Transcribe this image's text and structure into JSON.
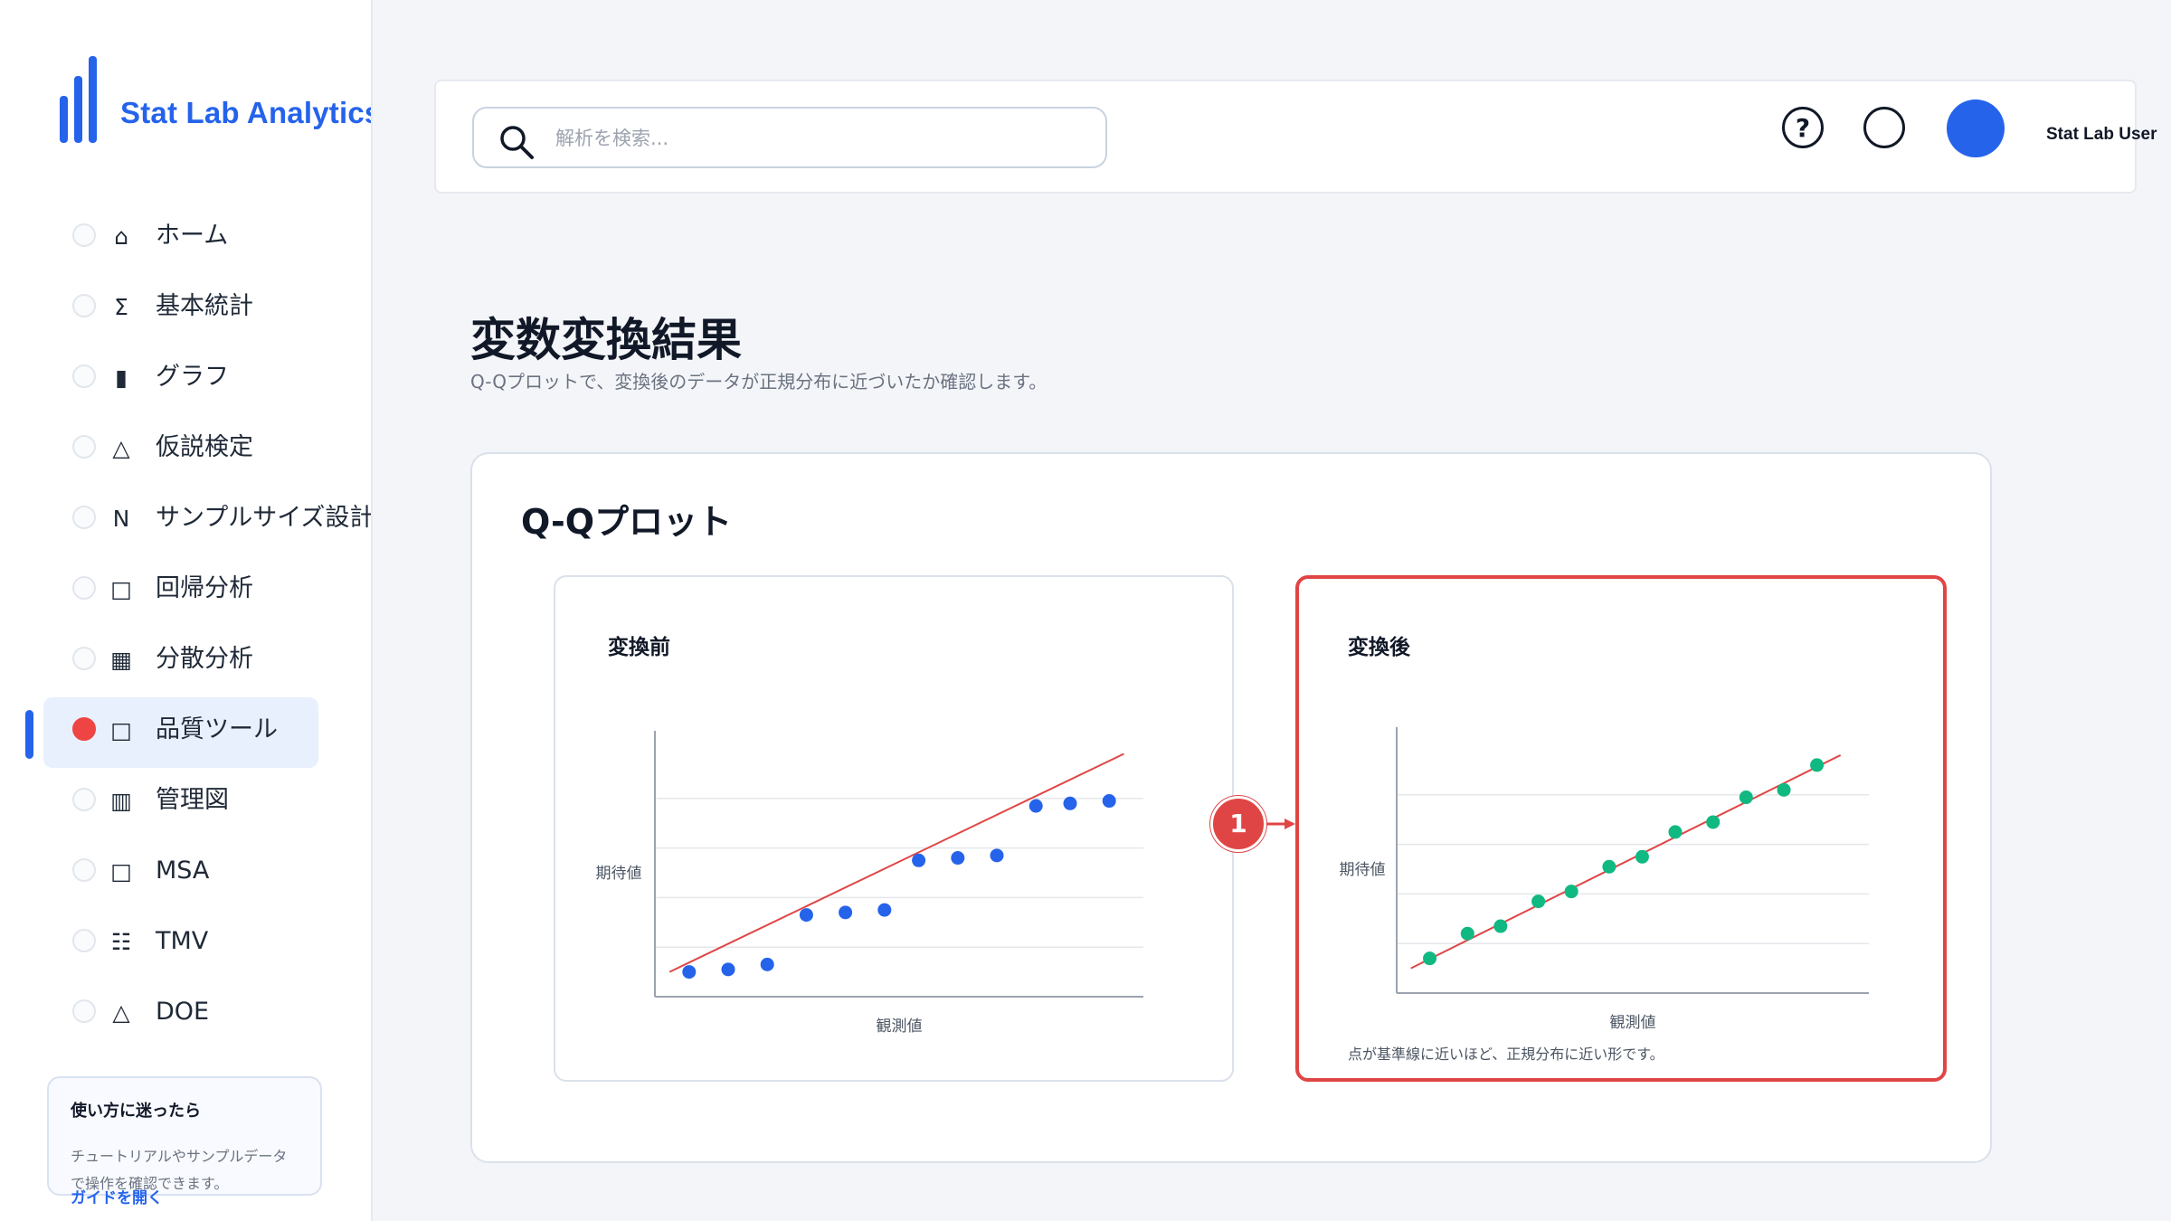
{
  "brand": {
    "name": "Stat Lab Analytics",
    "color": "#2563eb",
    "logo_icon": "bar-chart-logo-icon"
  },
  "sidebar": {
    "items": [
      {
        "icon": "⌂",
        "icon_name": "home-icon",
        "label": "ホーム",
        "active": false
      },
      {
        "icon": "Σ",
        "icon_name": "sigma-icon",
        "label": "基本統計",
        "active": false
      },
      {
        "icon": "▮",
        "icon_name": "bar-icon",
        "label": "グラフ",
        "active": false
      },
      {
        "icon": "△",
        "icon_name": "triangle-icon",
        "label": "仮説検定",
        "active": false
      },
      {
        "icon": "N",
        "icon_name": "n-icon",
        "label": "サンプルサイズ設計",
        "active": false
      },
      {
        "icon": "□",
        "icon_name": "square-icon",
        "label": "回帰分析",
        "active": false
      },
      {
        "icon": "▦",
        "icon_name": "grid-icon",
        "label": "分散分析",
        "active": false
      },
      {
        "icon": "□",
        "icon_name": "square-icon",
        "label": "品質ツール",
        "active": true
      },
      {
        "icon": "▥",
        "icon_name": "columns-icon",
        "label": "管理図",
        "active": false
      },
      {
        "icon": "□",
        "icon_name": "square-icon",
        "label": "MSA",
        "active": false
      },
      {
        "icon": "☷",
        "icon_name": "list-icon",
        "label": "TMV",
        "active": false
      },
      {
        "icon": "△",
        "icon_name": "triangle-icon",
        "label": "DOE",
        "active": false
      }
    ],
    "help": {
      "title": "使い方に迷ったら",
      "text": "チュートリアルやサンプルデータで操作を確認できます。",
      "link": "ガイドを開く"
    }
  },
  "header": {
    "search_placeholder": "解析を検索...",
    "help_icon_label": "?",
    "user_name": "Stat Lab User",
    "avatar_color": "#2563eb"
  },
  "main": {
    "title": "変数変換結果",
    "subtitle": "Q-Qプロットで、変換後のデータが正規分布に近づいたか確認します。",
    "card_title": "Q-Qプロット",
    "callout_number": "1",
    "note": "点が基準線に近いほど、正規分布に近い形です。"
  },
  "chart_data": [
    {
      "type": "scatter",
      "title": "変換前",
      "xlabel": "観測値",
      "ylabel": "期待値",
      "point_color": "#2563eb",
      "reference_line_color": "#e04545",
      "grid": true,
      "xlim": [
        0,
        1
      ],
      "ylim": [
        0,
        1
      ],
      "x": [
        0.07,
        0.15,
        0.23,
        0.31,
        0.39,
        0.47,
        0.54,
        0.62,
        0.7,
        0.78,
        0.85,
        0.93
      ],
      "y": [
        0.1,
        0.11,
        0.13,
        0.33,
        0.34,
        0.35,
        0.55,
        0.56,
        0.57,
        0.77,
        0.78,
        0.79
      ],
      "reference_line": [
        [
          0.03,
          0.1
        ],
        [
          0.96,
          0.98
        ]
      ]
    },
    {
      "type": "scatter",
      "title": "変換後",
      "xlabel": "観測値",
      "ylabel": "期待値",
      "point_color": "#10b981",
      "reference_line_color": "#e04545",
      "grid": true,
      "xlim": [
        0,
        1
      ],
      "ylim": [
        0,
        1
      ],
      "x": [
        0.07,
        0.15,
        0.22,
        0.3,
        0.37,
        0.45,
        0.52,
        0.59,
        0.67,
        0.74,
        0.82,
        0.89
      ],
      "y": [
        0.14,
        0.24,
        0.27,
        0.37,
        0.41,
        0.51,
        0.55,
        0.65,
        0.69,
        0.79,
        0.82,
        0.92
      ],
      "reference_line": [
        [
          0.03,
          0.1
        ],
        [
          0.94,
          0.96
        ]
      ]
    }
  ]
}
